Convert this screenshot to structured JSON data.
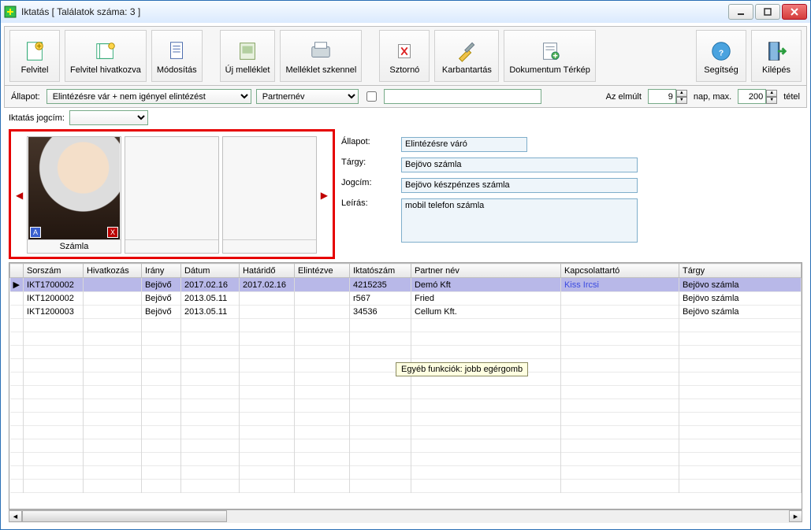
{
  "window": {
    "title": "Iktatás [ Találatok száma: 3 ]"
  },
  "toolbar": {
    "felvitel": "Felvitel",
    "felvitel_hivatkozva": "Felvitel hivatkozva",
    "modositas": "Módosítás",
    "uj_melleklet": "Új melléklet",
    "melleklet_szkennel": "Melléklet szkennel",
    "sztorno": "Sztornó",
    "karbantartas": "Karbantartás",
    "dokumentum_terkep": "Dokumentum Térkép",
    "segitseg": "Segítség",
    "kilepes": "Kilépés"
  },
  "filter": {
    "allapot_label": "Állapot:",
    "allapot_value": "Elintézésre vár + nem igényel elintézést",
    "second_select": "Partnernév",
    "az_elmult": "Az elmúlt",
    "days_value": "9",
    "nap_max": "nap, max.",
    "max_value": "200",
    "tetel": "tétel"
  },
  "sub": {
    "iktatas_jogcim": "Iktatás jogcím:"
  },
  "attach": {
    "caption0": "Számla"
  },
  "form": {
    "allapot_label": "Állapot:",
    "allapot_value": "Elintézésre váró",
    "targy_label": "Tárgy:",
    "targy_value": "Bejövo számla",
    "jogcim_label": "Jogcím:",
    "jogcim_value": "Bejövo készpénzes számla",
    "leiras_label": "Leírás:",
    "leiras_value": "mobil telefon számla"
  },
  "grid": {
    "headers": {
      "sorszam": "Sorszám",
      "hivatkozas": "Hivatkozás",
      "irany": "Irány",
      "datum": "Dátum",
      "hatarido": "Határidő",
      "elintezve": "Elintézve",
      "iktatoszam": "Iktatószám",
      "partnernev": "Partner név",
      "kapcsolattarto": "Kapcsolattartó",
      "targy": "Tárgy"
    },
    "rows": [
      {
        "sorszam": "IKT1700002",
        "hivatkozas": "",
        "irany": "Bejövő",
        "datum": "2017.02.16",
        "hatarido": "2017.02.16",
        "elintezve": "",
        "iktatoszam": "4215235",
        "partnernev": "Demó Kft",
        "kapcsolattarto": "Kiss Ircsi",
        "targy": "Bejövo számla",
        "selected": true
      },
      {
        "sorszam": "IKT1200002",
        "hivatkozas": "",
        "irany": "Bejövő",
        "datum": "2013.05.11",
        "hatarido": "",
        "elintezve": "",
        "iktatoszam": "r567",
        "partnernev": "Fried",
        "kapcsolattarto": "",
        "targy": "Bejövo számla"
      },
      {
        "sorszam": "IKT1200003",
        "hivatkozas": "",
        "irany": "Bejövő",
        "datum": "2013.05.11",
        "hatarido": "",
        "elintezve": "",
        "iktatoszam": "34536",
        "partnernev": "Cellum Kft.",
        "kapcsolattarto": "",
        "targy": "Bejövo számla"
      }
    ],
    "tooltip": "Egyéb funkciók: jobb egérgomb"
  }
}
